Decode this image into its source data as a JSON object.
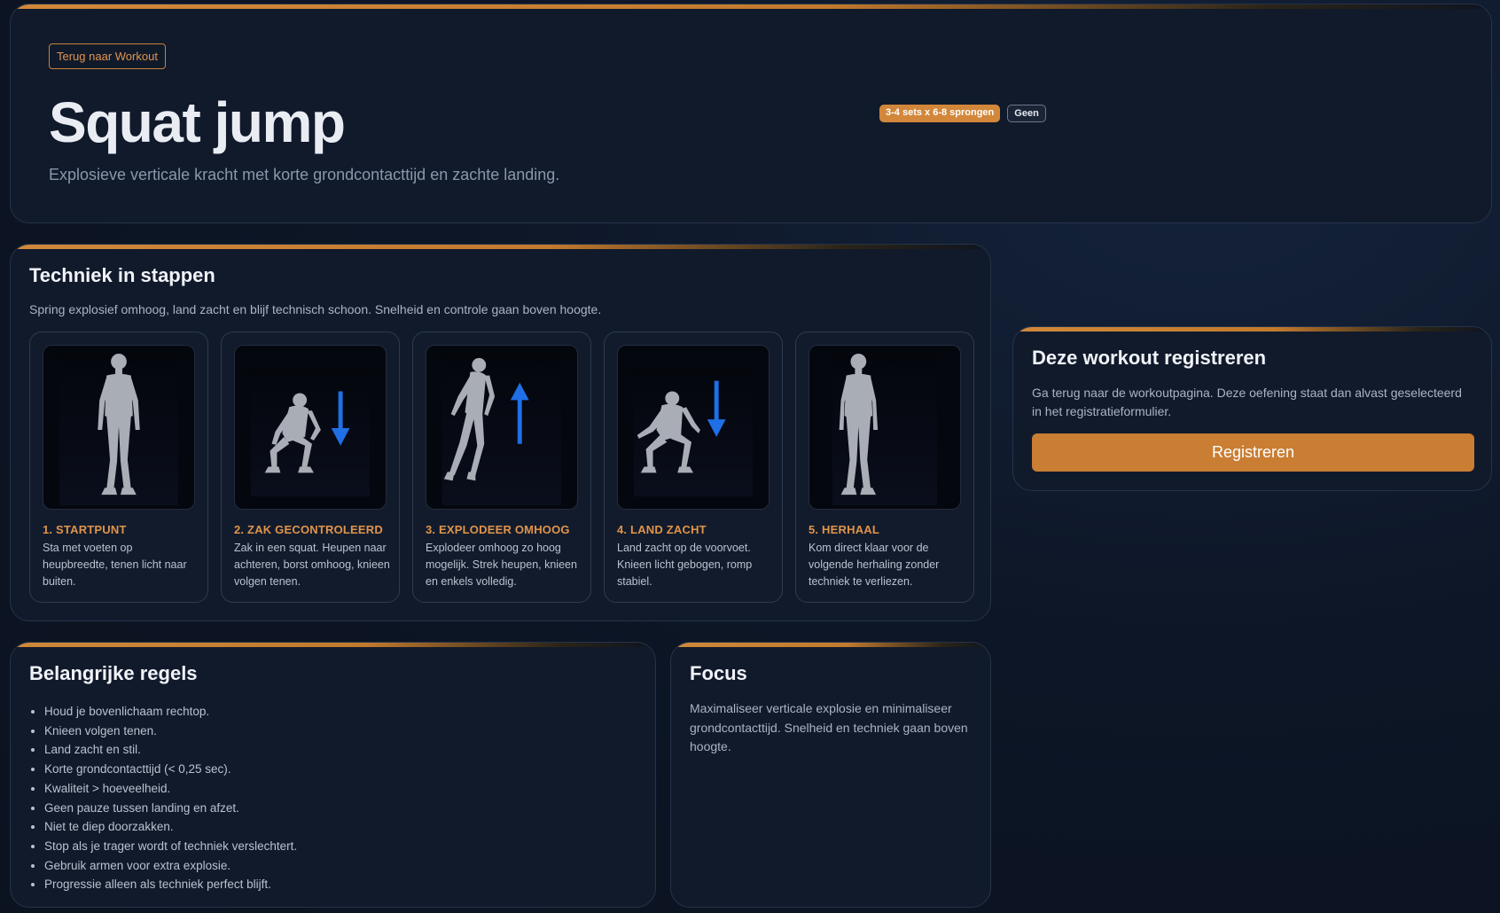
{
  "hero": {
    "back_label": "Terug naar Workout",
    "title": "Squat jump",
    "subtitle": "Explosieve verticale kracht met korte grondcontacttijd en zachte landing.",
    "badge_sets": "3-4 sets x 6-8 sprongen",
    "badge_equipment": "Geen"
  },
  "technique": {
    "title": "Techniek in stappen",
    "intro": "Spring explosief omhoog, land zacht en blijf technisch schoon. Snelheid en controle gaan boven hoogte.",
    "steps": [
      {
        "title": "1. STARTPUNT",
        "text": "Sta met voeten op heupbreedte, tenen licht naar buiten.",
        "arrow": "none"
      },
      {
        "title": "2. ZAK GECONTROLEERD",
        "text": "Zak in een squat. Heupen naar achteren, borst omhoog, knieen volgen tenen.",
        "arrow": "down"
      },
      {
        "title": "3. EXPLODEER OMHOOG",
        "text": "Explodeer omhoog zo hoog mogelijk. Strek heupen, knieen en enkels volledig.",
        "arrow": "up"
      },
      {
        "title": "4. LAND ZACHT",
        "text": "Land zacht op de voorvoet. Knieen licht gebogen, romp stabiel.",
        "arrow": "down"
      },
      {
        "title": "5. HERHAAL",
        "text": "Kom direct klaar voor de volgende herhaling zonder techniek te verliezen.",
        "arrow": "none"
      }
    ]
  },
  "register": {
    "title": "Deze workout registreren",
    "text": "Ga terug naar de workoutpagina. Deze oefening staat dan alvast geselecteerd in het registratieformulier.",
    "button_label": "Registreren"
  },
  "rules": {
    "title": "Belangrijke regels",
    "items": [
      "Houd je bovenlichaam rechtop.",
      "Knieen volgen tenen.",
      "Land zacht en stil.",
      "Korte grondcontacttijd (< 0,25 sec).",
      "Kwaliteit > hoeveelheid.",
      "Geen pauze tussen landing en afzet.",
      "Niet te diep doorzakken.",
      "Stop als je trager wordt of techniek verslechtert.",
      "Gebruik armen voor extra explosie.",
      "Progressie alleen als techniek perfect blijft."
    ]
  },
  "focus": {
    "title": "Focus",
    "text": "Maximaliseer verticale explosie en minimaliseer grondcontacttijd. Snelheid en techniek gaan boven hoogte."
  },
  "colors": {
    "accent": "#d0883a",
    "arrow": "#1f6fe6",
    "card_bg": "#111a2b"
  },
  "icons": {
    "standing": "standing-figure-icon",
    "squat": "squat-figure-icon",
    "jump": "jumping-figure-icon",
    "arrow_down": "arrow-down-icon",
    "arrow_up": "arrow-up-icon"
  }
}
